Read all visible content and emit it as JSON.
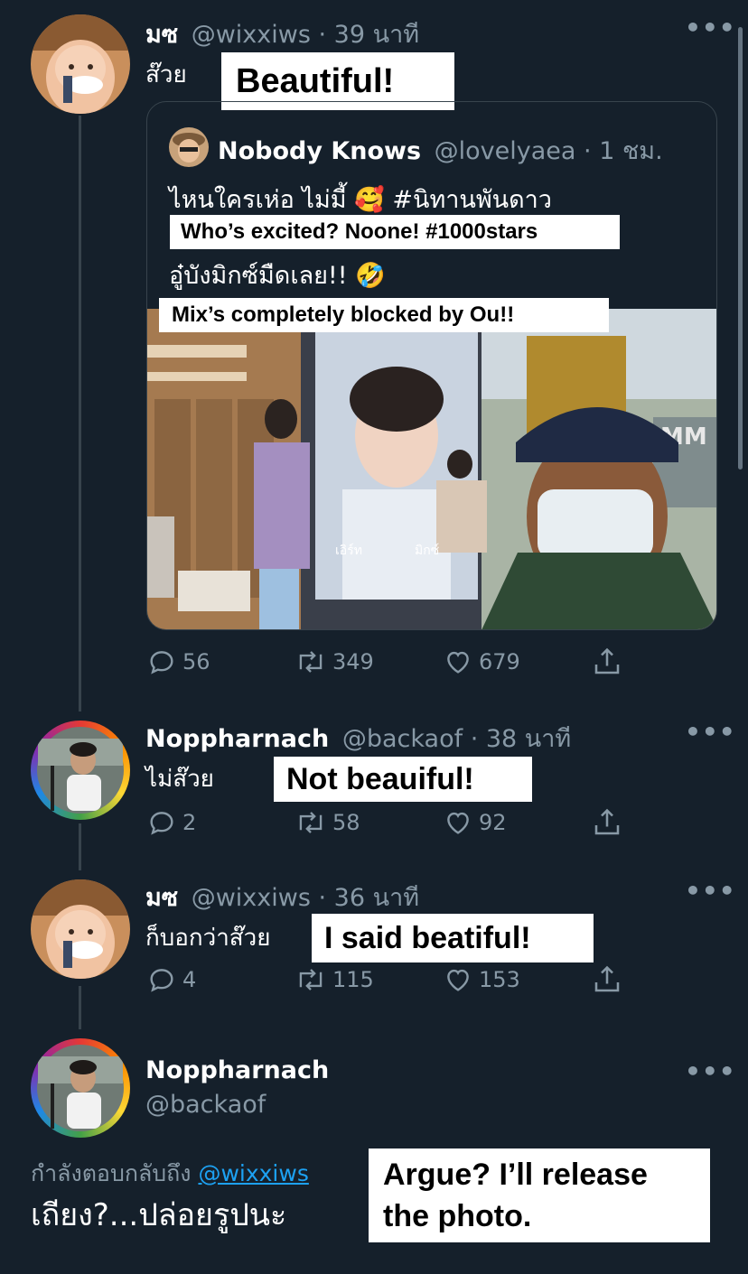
{
  "tweet1": {
    "name": "มซ",
    "handle": "@wixxiws",
    "time": "· 39 นาที",
    "text": "ส๊วย",
    "overlay": "Beautiful!"
  },
  "quote": {
    "name": "Nobody Knows",
    "handle": "@lovelyaea",
    "time": "· 1 ชม.",
    "line1": "ไหนใครเห่อ ไม่มี้ 🥰 #นิทานพันดาว",
    "overlay1": "Who’s excited? Noone! #1000stars",
    "line2": "อู๋บังมิกซ์มืดเลย!! 🤣",
    "overlay2": "Mix’s completely blocked by Ou!!",
    "photo_text_left": "เอิร์ท",
    "photo_text_right": "มิกซ์",
    "photo_sign": "MM"
  },
  "tweet1_actions": {
    "replies": "56",
    "retweets": "349",
    "likes": "679"
  },
  "tweet2": {
    "name": "Noppharnach",
    "handle": "@backaof",
    "time": "· 38 นาที",
    "text": "ไม่ส๊วย",
    "overlay": "Not beauiful!",
    "replies": "2",
    "retweets": "58",
    "likes": "92"
  },
  "tweet3": {
    "name": "มซ",
    "handle": "@wixxiws",
    "time": "· 36 นาที",
    "text": "ก็บอกว่าส๊วย",
    "overlay": "I said beatiful!",
    "replies": "4",
    "retweets": "115",
    "likes": "153"
  },
  "tweet4": {
    "name": "Noppharnach",
    "handle": "@backaof",
    "replying_prefix": "กำลังตอบกลับถึง",
    "replying_to": "@wixxiws",
    "text": "เถียง?...ปล่อยรูปนะ",
    "overlay_line1": "Argue? I’ll release",
    "overlay_line2": "the photo."
  },
  "icons": {
    "more": "more-horizontal-icon",
    "reply": "reply-icon",
    "retweet": "retweet-icon",
    "like": "heart-icon",
    "share": "share-icon"
  },
  "colors": {
    "background": "#15202b",
    "secondary_text": "#8899a6",
    "border": "#38444d",
    "link": "#1da1f2"
  }
}
